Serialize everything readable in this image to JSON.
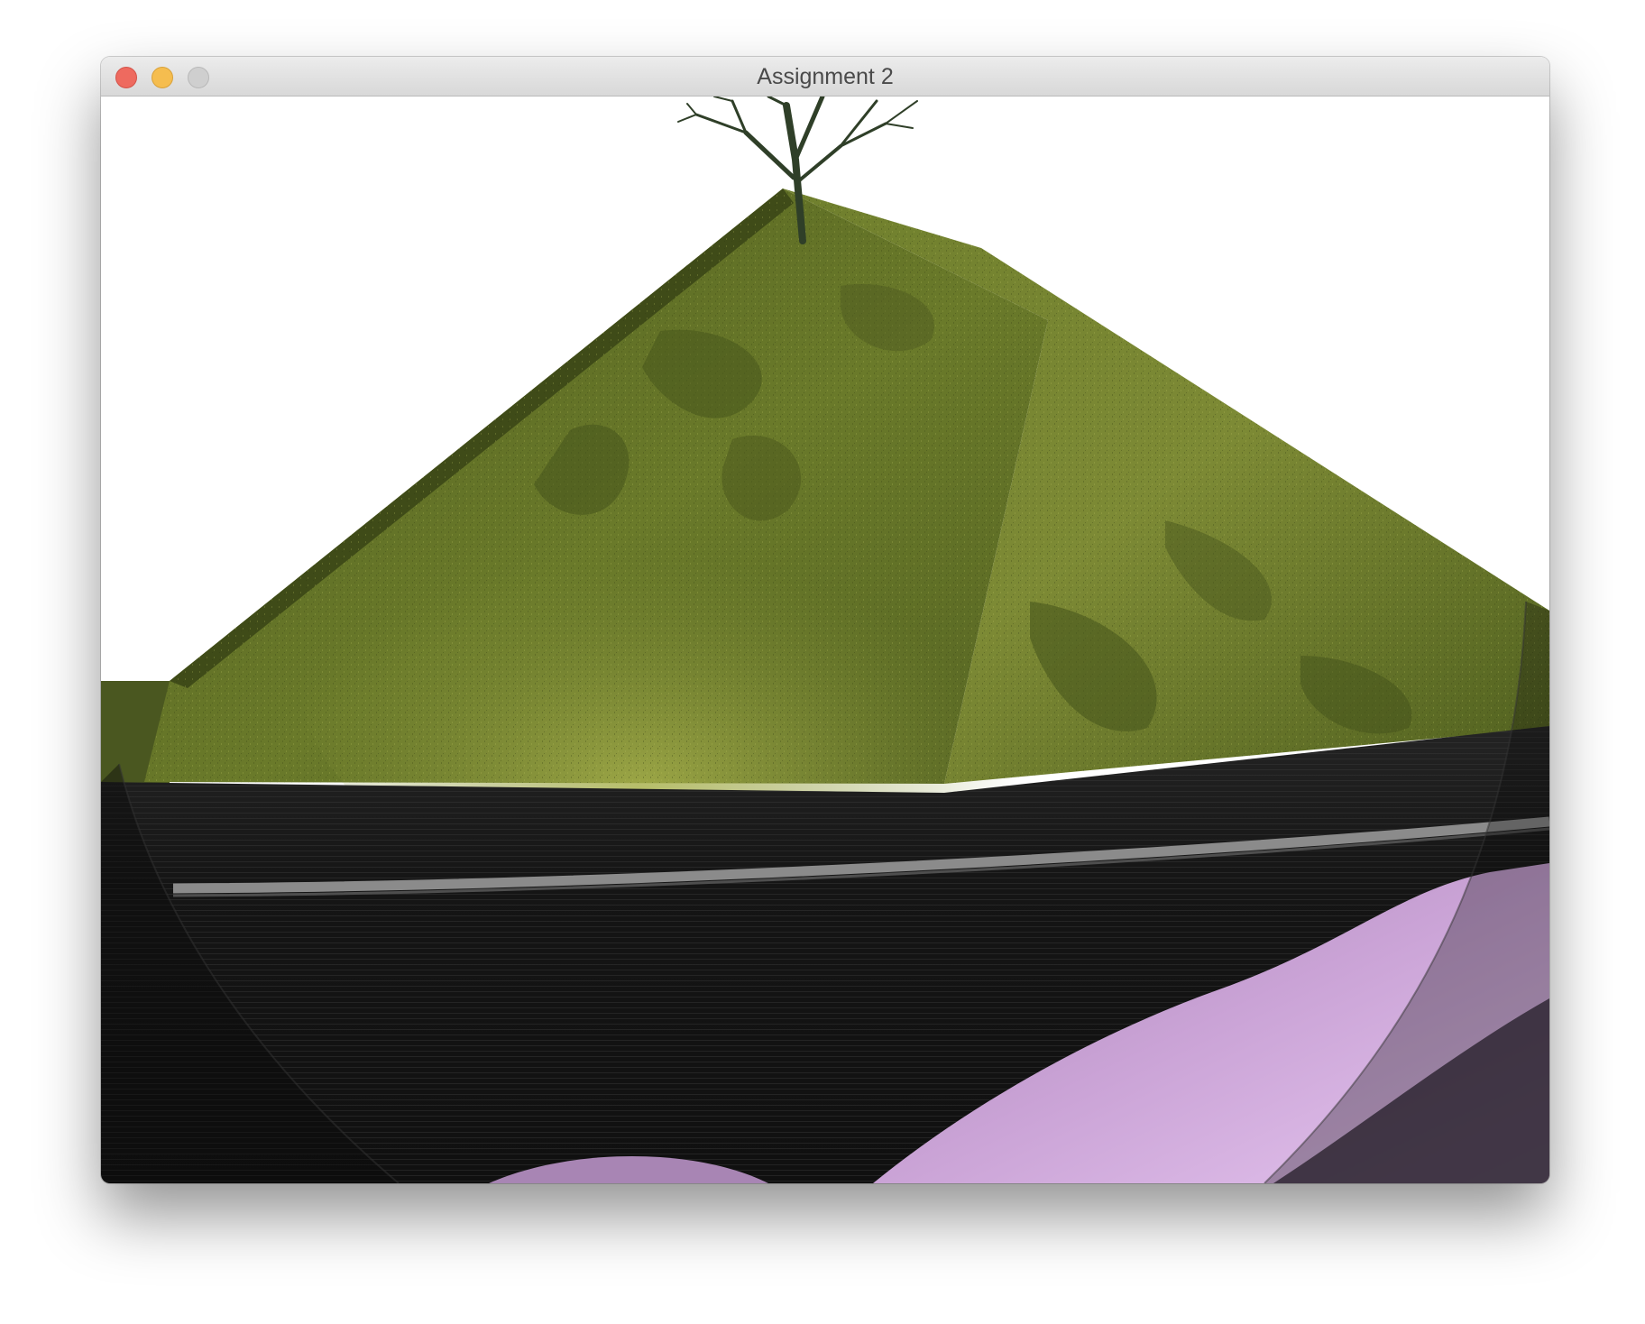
{
  "window": {
    "title": "Assignment 2"
  },
  "traffic_lights": {
    "close": "close-button",
    "minimize": "minimize-button",
    "zoom": "zoom-button"
  },
  "scene": {
    "colors": {
      "sky": "#ffffff",
      "grass_dark": "#4d5a1c",
      "grass_mid": "#6f7e2c",
      "grass_light": "#9aa545",
      "asphalt": "#1b1b1b",
      "stripe": "#8b8b8b",
      "purple": "#b793c4",
      "tree": "#2f3f28"
    }
  }
}
